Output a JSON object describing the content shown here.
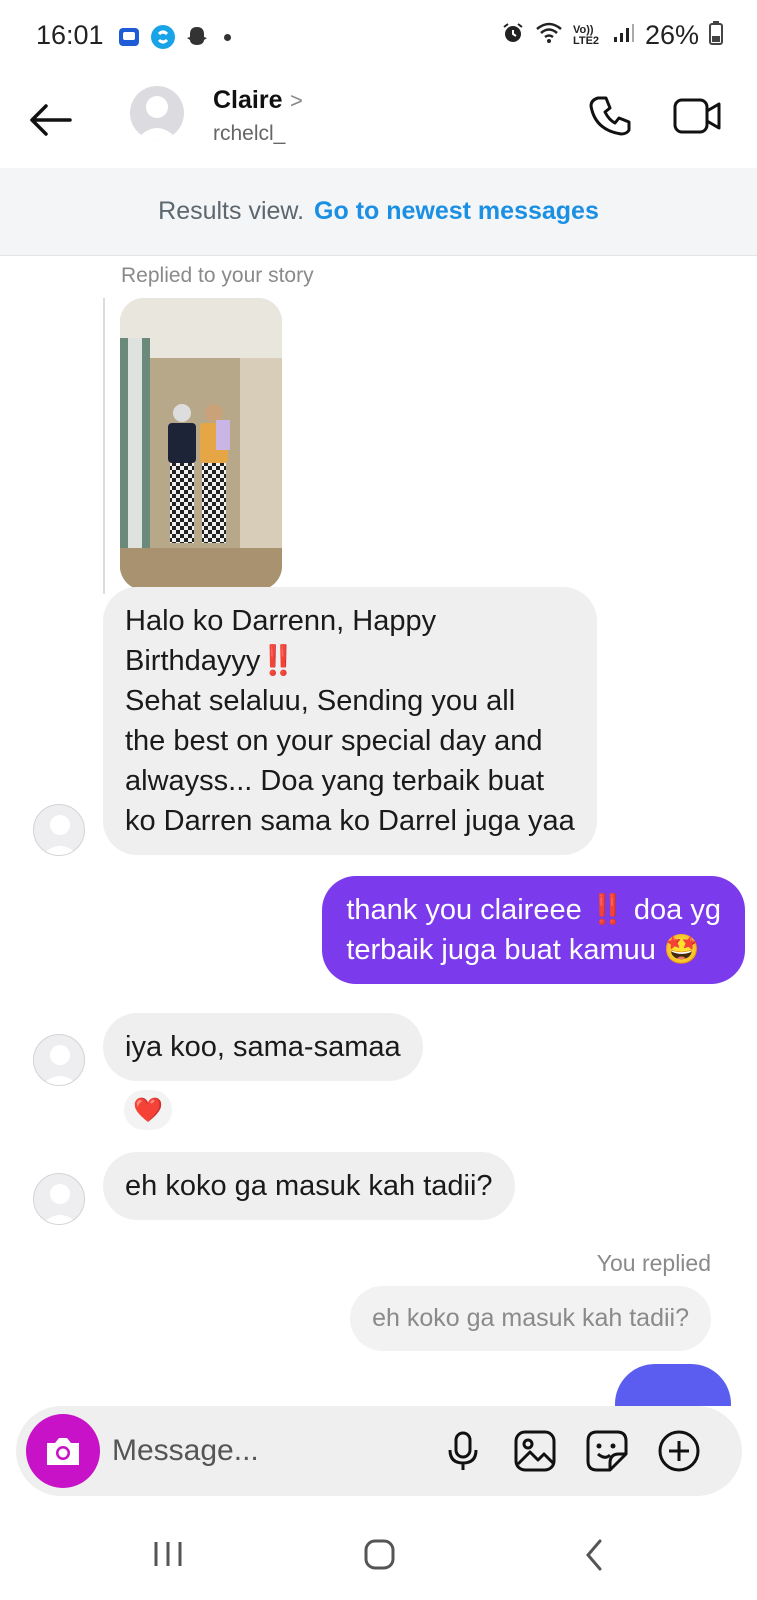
{
  "status_bar": {
    "time": "16:01",
    "battery": "26%",
    "network": "Vo)) LTE2"
  },
  "header": {
    "contact_name": "Claire",
    "contact_handle": "rchelcl_",
    "name_chevron": ">",
    "icons": [
      "back-arrow-icon",
      "phone-icon",
      "video-camera-icon"
    ]
  },
  "results_banner": {
    "label": "Results view.",
    "link": "Go to newest messages"
  },
  "chat": {
    "story_reply_label": "Replied to your story",
    "messages": [
      {
        "sender": "them",
        "text": "Halo ko Darrenn, Happy\nBirthdayyy‼️\nSehat selaluu, Sending you all\nthe best on your special day and\nalwayss... Doa yang terbaik buat\nko Darren sama ko Darrel juga yaa"
      },
      {
        "sender": "me",
        "text": "thank you claireee ‼️ doa yg\nterbaik juga buat kamuu 🤩"
      },
      {
        "sender": "them",
        "text": "iya koo, sama-samaa",
        "reaction": "❤️"
      },
      {
        "sender": "them",
        "text": "eh koko ga masuk kah tadii?"
      }
    ],
    "you_replied_label": "You replied",
    "quoted_text": "eh koko ga masuk kah tadii?"
  },
  "composer": {
    "placeholder": "Message...",
    "icons": [
      "camera-icon",
      "microphone-icon",
      "gallery-icon",
      "sticker-icon",
      "add-icon"
    ]
  },
  "colors": {
    "outgoing_bubble": "#7c3aed",
    "incoming_bubble": "#efefef",
    "link": "#1a8fe3",
    "camera_button": "#c712c8"
  }
}
